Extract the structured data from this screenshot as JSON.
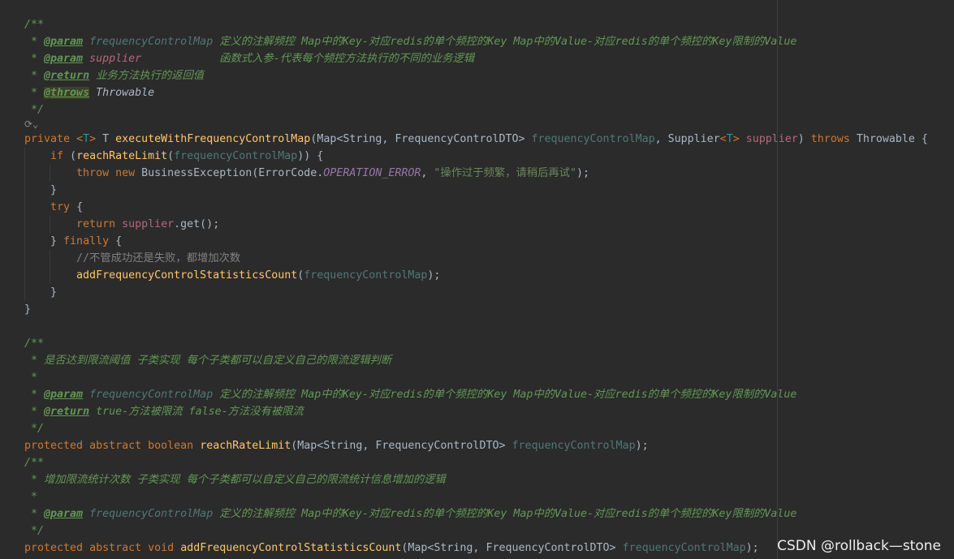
{
  "watermark": "CSDN @rollback—stone",
  "lines": [
    "/**",
    " * @param frequencyControlMap 定义的注解频控 Map中的Key-对应redis的单个频控的Key Map中的Value-对应redis的单个频控的Key限制的Value",
    " * @param supplier            函数式入参-代表每个频控方法执行的不同的业务逻辑",
    " * @return 业务方法执行的返回值",
    " * @throws Throwable",
    " */",
    "",
    "private <T> T executeWithFrequencyControlMap(Map<String, FrequencyControlDTO> frequencyControlMap, Supplier<T> supplier) throws Throwable {",
    "    if (reachRateLimit(frequencyControlMap)) {",
    "        throw new BusinessException(ErrorCode.OPERATION_ERROR, \"操作过于频繁，请稍后再试\");",
    "    }",
    "    try {",
    "        return supplier.get();",
    "    } finally {",
    "        //不管成功还是失败，都增加次数",
    "        addFrequencyControlStatisticsCount(frequencyControlMap);",
    "    }",
    "}",
    "",
    "/**",
    " * 是否达到限流阈值 子类实现 每个子类都可以自定义自己的限流逻辑判断",
    " *",
    " * @param frequencyControlMap 定义的注解频控 Map中的Key-对应redis的单个频控的Key Map中的Value-对应redis的单个频控的Key限制的Value",
    " * @return true-方法被限流 false-方法没有被限流",
    " */",
    "protected abstract boolean reachRateLimit(Map<String, FrequencyControlDTO> frequencyControlMap);",
    "/**",
    " * 增加限流统计次数 子类实现 每个子类都可以自定义自己的限流统计信息增加的逻辑",
    " *",
    " * @param frequencyControlMap 定义的注解频控 Map中的Key-对应redis的单个频控的Key Map中的Value-对应redis的单个频控的Key限制的Value",
    " */",
    "protected abstract void addFrequencyControlStatisticsCount(Map<String, FrequencyControlDTO> frequencyControlMap);"
  ]
}
